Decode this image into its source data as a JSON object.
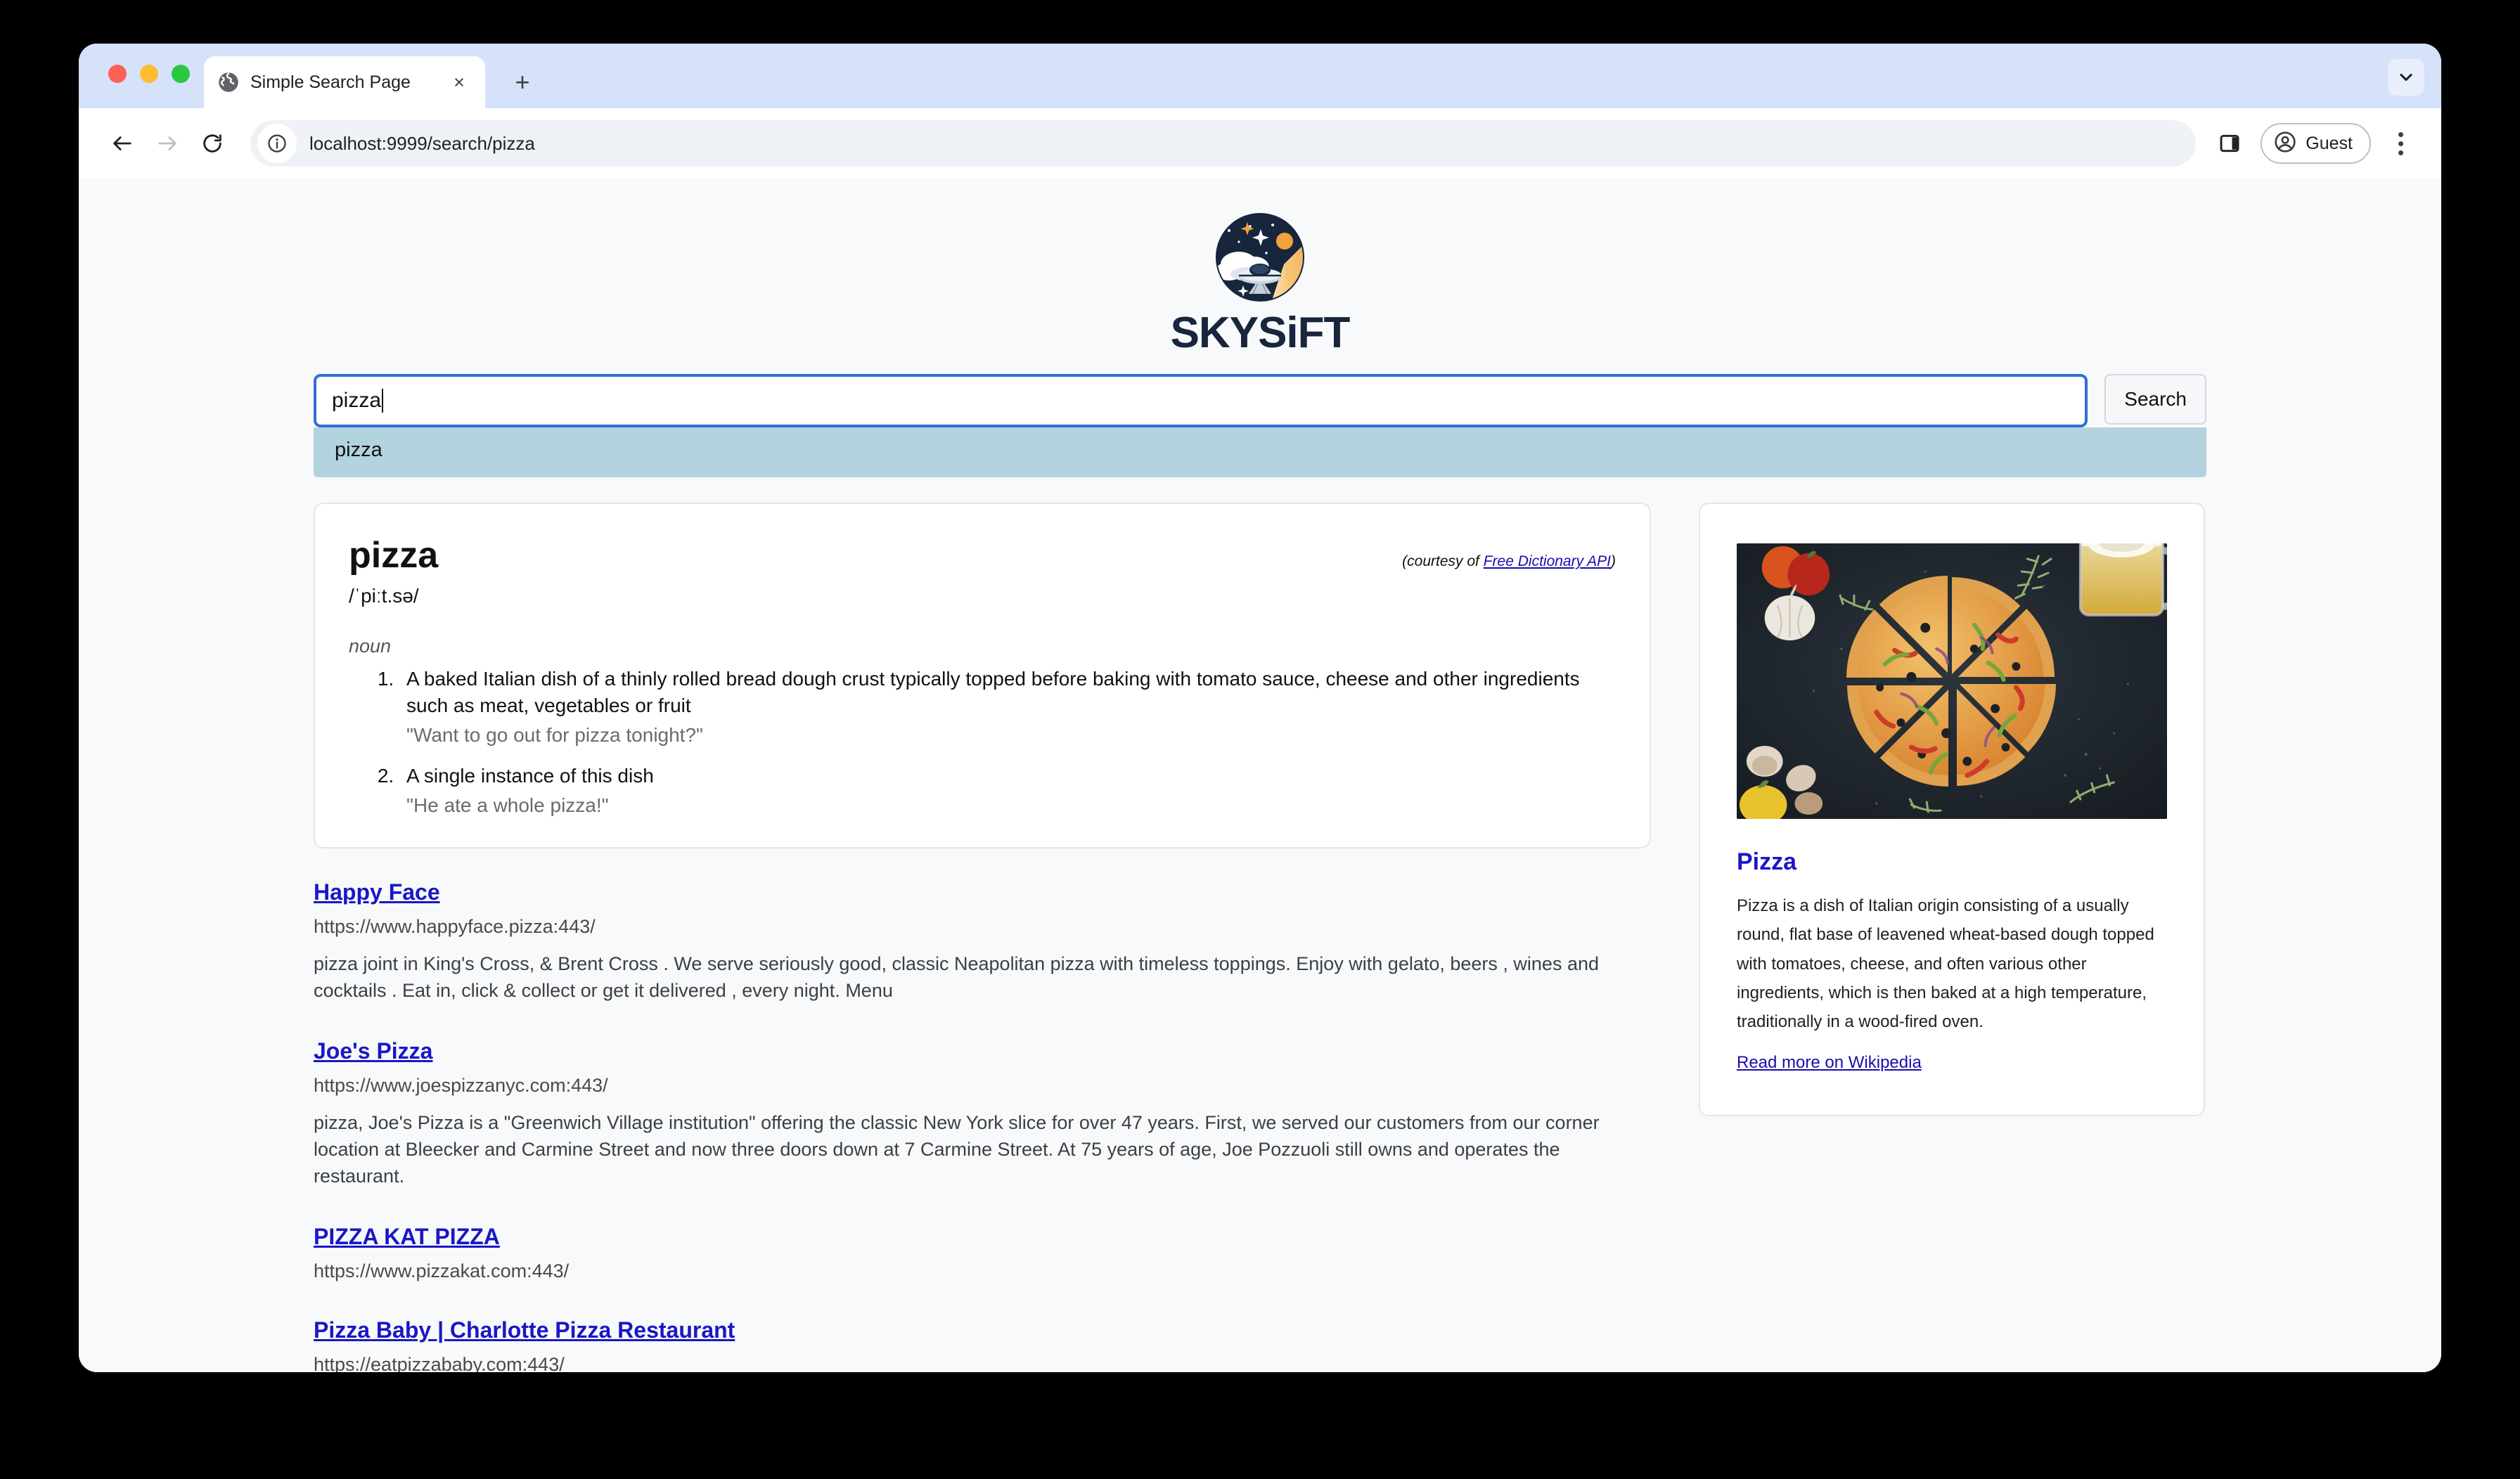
{
  "browser": {
    "tab": {
      "title": "Simple Search Page",
      "favicon": "globe-icon",
      "close": "×"
    },
    "new_tab_label": "+",
    "url": "localhost:9999/search/pizza",
    "profile_label": "Guest",
    "traffic_lights": [
      "close-red",
      "minimize-yellow",
      "zoom-green"
    ]
  },
  "logo": {
    "wordmark": "SKYSiFT",
    "colors": {
      "ink": "#17263c",
      "sun": "#f0a23c",
      "ray": "#f2a93b",
      "cloud": "#ffffff"
    }
  },
  "search": {
    "value": "pizza",
    "placeholder": "Search",
    "button_label": "Search",
    "suggestions": [
      "pizza"
    ]
  },
  "dictionary": {
    "word": "pizza",
    "phonetic": "/ˈpiːt.sə/",
    "courtesy_prefix": "(courtesy of ",
    "courtesy_link": "Free Dictionary API",
    "courtesy_suffix": ")",
    "part_of_speech": "noun",
    "definitions": [
      {
        "text": "A baked Italian dish of a thinly rolled bread dough crust typically topped before baking with tomato sauce, cheese and other ingredients such as meat, vegetables or fruit",
        "example": "\"Want to go out for pizza tonight?\""
      },
      {
        "text": "A single instance of this dish",
        "example": "\"He ate a whole pizza!\""
      }
    ]
  },
  "results": [
    {
      "title": "Happy Face",
      "url": "https://www.happyface.pizza:443/",
      "snippet": "pizza joint in King's Cross, & Brent Cross . We serve seriously good, classic Neapolitan pizza with timeless toppings. Enjoy with gelato, beers , wines and cocktails . Eat in, click & collect or get it delivered , every night. Menu"
    },
    {
      "title": "Joe's Pizza",
      "url": "https://www.joespizzanyc.com:443/",
      "snippet": "pizza, Joe's Pizza is a \"Greenwich Village institution\" offering the classic New York slice for over 47 years.  First,  we served our customers from our corner location at Bleecker and Carmine Street and now three doors down at 7 Carmine Street.  At 75 years of age, Joe Pozzuoli still owns and operates the restaurant."
    },
    {
      "title": "PIZZA KAT PIZZA",
      "url": "https://www.pizzakat.com:443/",
      "snippet": ""
    },
    {
      "title": "Pizza Baby | Charlotte Pizza Restaurant",
      "url": "https://eatpizzababy.com:443/",
      "snippet": ""
    }
  ],
  "knowledge_panel": {
    "image_alt": "sliced-pizza-photo",
    "title": "Pizza",
    "description": "Pizza is a dish of Italian origin consisting of a usually round, flat base of leavened wheat-based dough topped with tomatoes, cheese, and often various other ingredients, which is then baked at a high temperature, traditionally in a wood-fired oven.",
    "link_label": "Read more on Wikipedia"
  }
}
